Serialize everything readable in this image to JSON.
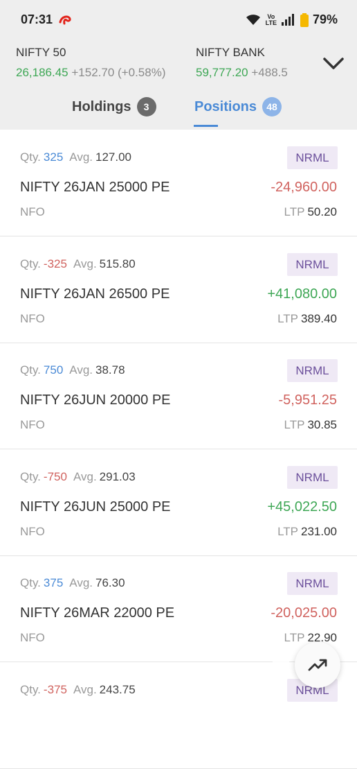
{
  "status_bar": {
    "time": "07:31",
    "network_label": "Vo LTE",
    "battery": "79%"
  },
  "indices": [
    {
      "name": "NIFTY 50",
      "price": "26,186.45",
      "change": "+152.70 (+0.58%)"
    },
    {
      "name": "NIFTY BANK",
      "price": "59,777.20",
      "change": "+488.5"
    }
  ],
  "tabs": [
    {
      "label": "Holdings",
      "count": "3"
    },
    {
      "label": "Positions",
      "count": "48"
    }
  ],
  "labels": {
    "qty": "Qty.",
    "avg": "Avg.",
    "ltp": "LTP"
  },
  "positions": [
    {
      "qty": "325",
      "avg": "127.00",
      "product": "NRML",
      "instrument": "NIFTY 26JAN 25000 PE",
      "pnl": "-24,960.00",
      "exchange": "NFO",
      "ltp": "50.20"
    },
    {
      "qty": "-325",
      "avg": "515.80",
      "product": "NRML",
      "instrument": "NIFTY 26JAN 26500 PE",
      "pnl": "+41,080.00",
      "exchange": "NFO",
      "ltp": "389.40"
    },
    {
      "qty": "750",
      "avg": "38.78",
      "product": "NRML",
      "instrument": "NIFTY 26JUN 20000 PE",
      "pnl": "-5,951.25",
      "exchange": "NFO",
      "ltp": "30.85"
    },
    {
      "qty": "-750",
      "avg": "291.03",
      "product": "NRML",
      "instrument": "NIFTY 26JUN 25000 PE",
      "pnl": "+45,022.50",
      "exchange": "NFO",
      "ltp": "231.00"
    },
    {
      "qty": "375",
      "avg": "76.30",
      "product": "NRML",
      "instrument": "NIFTY 26MAR 22000 PE",
      "pnl": "-20,025.00",
      "exchange": "NFO",
      "ltp": "22.90"
    },
    {
      "qty": "-375",
      "avg": "243.75",
      "product": "NRML",
      "instrument": "",
      "pnl": "",
      "exchange": "",
      "ltp": ""
    }
  ],
  "colors": {
    "gain": "#3ea755",
    "loss": "#d0625e",
    "accent": "#4a8ad6"
  },
  "watermark": "olx"
}
